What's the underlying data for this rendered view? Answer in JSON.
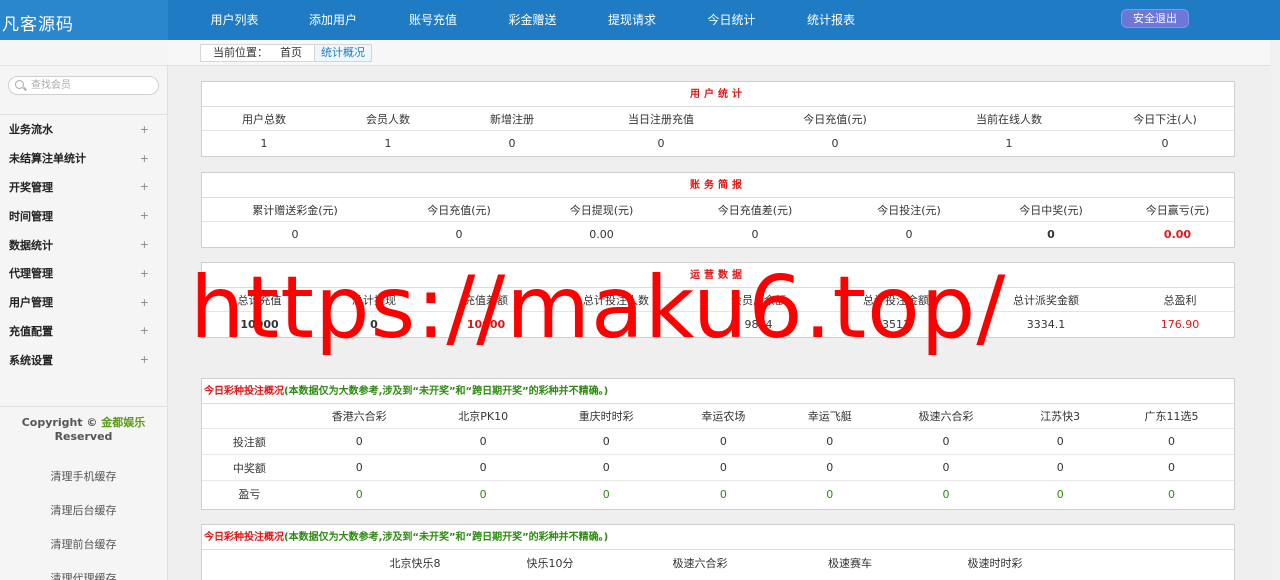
{
  "app": {
    "logo": "凡客源码",
    "nav": [
      "用户列表",
      "添加用户",
      "账号充值",
      "彩金赠送",
      "提现请求",
      "今日统计",
      "统计报表"
    ],
    "logout": "安全退出"
  },
  "sidebar": {
    "search_placeholder": "查找会员",
    "items": [
      "业务流水",
      "未结算注单统计",
      "开奖管理",
      "时间管理",
      "数据统计",
      "代理管理",
      "用户管理",
      "充值配置",
      "系统设置"
    ],
    "expand_glyph": "+",
    "copyright_prefix": "Copyright ©",
    "copyright_brand": "金都娱乐",
    "copyright_suffix": "Reserved",
    "links": [
      "清理手机缓存",
      "清理后台缓存",
      "清理前台缓存",
      "清理代理缓存"
    ]
  },
  "breadcrumb": {
    "label": "当前位置：",
    "home": "首页",
    "current": "统计概况"
  },
  "user_stats": {
    "title": "用户统计",
    "headers": [
      "用户总数",
      "会员人数",
      "新增注册",
      "当日注册充值",
      "今日充值(元)",
      "当前在线人数",
      "今日下注(人)"
    ],
    "values": [
      "1",
      "1",
      "0",
      "0",
      "0",
      "1",
      "0"
    ]
  },
  "finance": {
    "title": "账务简报",
    "headers": [
      "累计赠送彩金(元)",
      "今日充值(元)",
      "今日提现(元)",
      "今日充值差(元)",
      "今日投注(元)",
      "今日中奖(元)",
      "今日赢亏(元)"
    ],
    "values": [
      "0",
      "0",
      "0.00",
      "0",
      "0",
      "0",
      "0.00"
    ]
  },
  "operations": {
    "title": "运营数据",
    "headers": [
      "总计充值",
      "总计提现",
      "充值差额",
      "总计投注人数",
      "会员总余额",
      "总计投注金额",
      "总计派奖金额",
      "总盈利"
    ],
    "values": [
      "10000",
      "0",
      "10000",
      "",
      "9834",
      "3511",
      "3334.1",
      "176.90"
    ]
  },
  "lottery_today_1": {
    "title": "今日彩种投注概况",
    "note": "(本数据仅为大数参考,涉及到“未开奖”和“跨日期开奖”的彩种并不精确。)",
    "columns": [
      "香港六合彩",
      "北京PK10",
      "重庆时时彩",
      "幸运农场",
      "幸运飞艇",
      "极速六合彩",
      "江苏快3",
      "广东11选5"
    ],
    "rows": [
      {
        "label": "投注额",
        "values": [
          "0",
          "0",
          "0",
          "0",
          "0",
          "0",
          "0",
          "0"
        ]
      },
      {
        "label": "中奖额",
        "values": [
          "0",
          "0",
          "0",
          "0",
          "0",
          "0",
          "0",
          "0"
        ]
      },
      {
        "label": "盈亏",
        "values": [
          "0",
          "0",
          "0",
          "0",
          "0",
          "0",
          "0",
          "0"
        ]
      }
    ]
  },
  "lottery_today_2": {
    "title": "今日彩种投注概况",
    "note": "(本数据仅为大数参考,涉及到“未开奖”和“跨日期开奖”的彩种并不精确。)",
    "columns": [
      "北京快乐8",
      "快乐10分",
      "极速六合彩",
      "极速赛车",
      "极速时时彩"
    ]
  },
  "watermark": "https://maku6.top/",
  "colors": {
    "topbar": "#1f7cc4",
    "accent_red": "#e31616",
    "accent_green": "#2e8b12",
    "watermark": "#ff0000"
  }
}
